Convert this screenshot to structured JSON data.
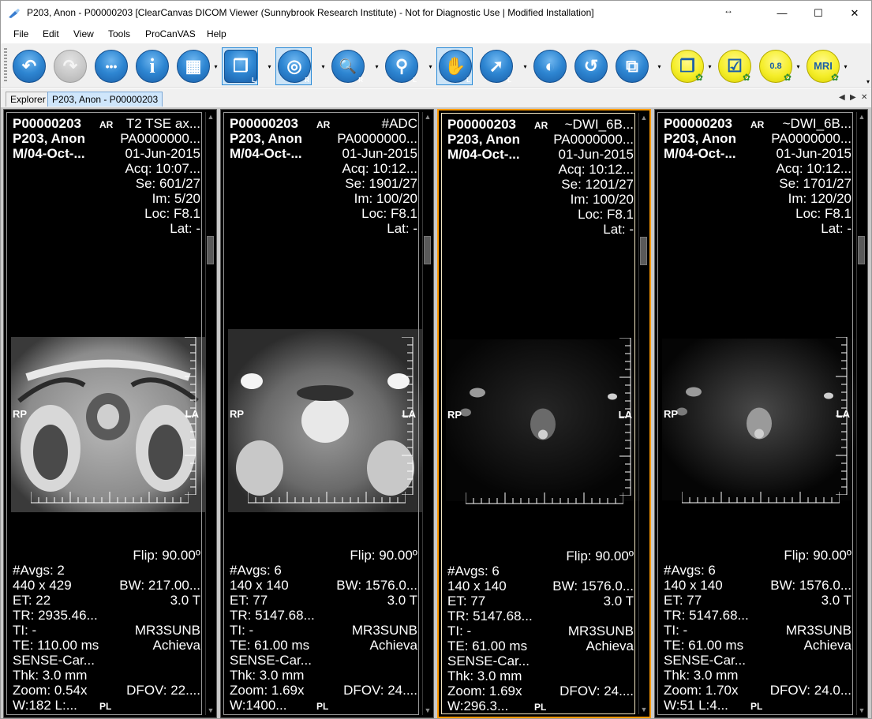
{
  "window": {
    "title": "P203, Anon - P00000203 [ClearCanvas DICOM Viewer (Sunnybrook Research Institute) - Not for Diagnostic Use | Modified Installation]",
    "resize_glyph": "↔",
    "minimize": "—",
    "maximize": "☐",
    "close": "✕"
  },
  "menu": [
    "File",
    "Edit",
    "View",
    "Tools",
    "ProCanVAS",
    "Help"
  ],
  "toolbar": {
    "buttons": [
      {
        "name": "back-icon",
        "glyph": "↶"
      },
      {
        "name": "forward-icon",
        "glyph": "↷"
      },
      {
        "name": "ellipsis-icon",
        "glyph": "•••"
      },
      {
        "name": "info-icon",
        "glyph": "i"
      },
      {
        "name": "layout-icon",
        "glyph": "▦"
      },
      {
        "name": "stack-icon",
        "glyph": "❐",
        "sub": "L"
      },
      {
        "name": "probe-icon",
        "glyph": "◎",
        "sub": "R"
      },
      {
        "name": "zoom-icon",
        "glyph": "🔍",
        "sub": "R"
      },
      {
        "name": "magnify-icon",
        "glyph": "⚲",
        "sub": "L"
      },
      {
        "name": "pan-icon",
        "glyph": "✋",
        "sub": "L"
      },
      {
        "name": "select-icon",
        "glyph": "➚",
        "sub": "L"
      },
      {
        "name": "invert-icon",
        "glyph": "◐"
      },
      {
        "name": "reset-icon",
        "glyph": "↺"
      },
      {
        "name": "sync-icon",
        "glyph": "⧉"
      },
      {
        "name": "procanvas-stack-icon",
        "glyph": "❐"
      },
      {
        "name": "procanvas-check-icon",
        "glyph": "☑"
      },
      {
        "name": "procanvas-08-icon",
        "glyph": "0.8"
      },
      {
        "name": "procanvas-mri-icon",
        "glyph": "MRI"
      }
    ],
    "overflow": "▾"
  },
  "tabs": {
    "explorer": "Explorer",
    "study": "P203, Anon - P00000203",
    "nav_prev": "◀",
    "nav_next": "▶",
    "nav_close": "✕"
  },
  "viewports": [
    {
      "patient_id": "P00000203",
      "patient_name": "P203, Anon",
      "sex_dob": "M/04-Oct-...",
      "orient_top": "AR",
      "series_desc": "T2 TSE ax...",
      "accession": "PA0000000...",
      "study_date": "01-Jun-2015",
      "acq": "Acq: 10:07...",
      "se": "Se: 601/27",
      "im": "Im: 5/20",
      "loc": "Loc: F8.1",
      "lat": "Lat: -",
      "flip": "Flip: 90.00º",
      "avgs": "#Avgs: 2",
      "matrix": "440 x 429",
      "bw": "BW: 217.00...",
      "et": "ET: 22",
      "tesla": "3.0 T",
      "tr": "TR: 2935.46...",
      "ti": "TI: -",
      "station": "MR3SUNB",
      "te": "TE: 110.00 ms",
      "model": "Achieva",
      "coil": "SENSE-Car...",
      "thk": "Thk: 3.0 mm",
      "zoom": "Zoom: 0.54x",
      "dfov": "DFOV: 22....",
      "wl": "W:182 L:...",
      "orient_bottom": "PL",
      "orient_left": "RP",
      "orient_right": "LA"
    },
    {
      "patient_id": "P00000203",
      "patient_name": "P203, Anon",
      "sex_dob": "M/04-Oct-...",
      "orient_top": "AR",
      "series_desc": "#ADC",
      "accession": "PA0000000...",
      "study_date": "01-Jun-2015",
      "acq": "Acq: 10:12...",
      "se": "Se: 1901/27",
      "im": "Im: 100/20",
      "loc": "Loc: F8.1",
      "lat": "Lat: -",
      "flip": "Flip: 90.00º",
      "avgs": "#Avgs: 6",
      "matrix": "140 x 140",
      "bw": "BW: 1576.0...",
      "et": "ET: 77",
      "tesla": "3.0 T",
      "tr": "TR: 5147.68...",
      "ti": "TI: -",
      "station": "MR3SUNB",
      "te": "TE: 61.00 ms",
      "model": "Achieva",
      "coil": "SENSE-Car...",
      "thk": "Thk: 3.0 mm",
      "zoom": "Zoom: 1.69x",
      "dfov": "DFOV: 24....",
      "wl": "W:1400...",
      "orient_bottom": "PL",
      "orient_left": "RP",
      "orient_right": "LA"
    },
    {
      "patient_id": "P00000203",
      "patient_name": "P203, Anon",
      "sex_dob": "M/04-Oct-...",
      "orient_top": "AR",
      "series_desc": "~DWI_6B...",
      "accession": "PA0000000...",
      "study_date": "01-Jun-2015",
      "acq": "Acq: 10:12...",
      "se": "Se: 1201/27",
      "im": "Im: 100/20",
      "loc": "Loc: F8.1",
      "lat": "Lat: -",
      "flip": "Flip: 90.00º",
      "avgs": "#Avgs: 6",
      "matrix": "140 x 140",
      "bw": "BW: 1576.0...",
      "et": "ET: 77",
      "tesla": "3.0 T",
      "tr": "TR: 5147.68...",
      "ti": "TI: -",
      "station": "MR3SUNB",
      "te": "TE: 61.00 ms",
      "model": "Achieva",
      "coil": "SENSE-Car...",
      "thk": "Thk: 3.0 mm",
      "zoom": "Zoom: 1.69x",
      "dfov": "DFOV: 24....",
      "wl": "W:296.3...",
      "orient_bottom": "PL",
      "orient_left": "RP",
      "orient_right": "LA"
    },
    {
      "patient_id": "P00000203",
      "patient_name": "P203, Anon",
      "sex_dob": "M/04-Oct-...",
      "orient_top": "AR",
      "series_desc": "~DWI_6B...",
      "accession": "PA0000000...",
      "study_date": "01-Jun-2015",
      "acq": "Acq: 10:12...",
      "se": "Se: 1701/27",
      "im": "Im: 120/20",
      "loc": "Loc: F8.1",
      "lat": "Lat: -",
      "flip": "Flip: 90.00º",
      "avgs": "#Avgs: 6",
      "matrix": "140 x 140",
      "bw": "BW: 1576.0...",
      "et": "ET: 77",
      "tesla": "3.0 T",
      "tr": "TR: 5147.68...",
      "ti": "TI: -",
      "station": "MR3SUNB",
      "te": "TE: 61.00 ms",
      "model": "Achieva",
      "coil": "SENSE-Car...",
      "thk": "Thk: 3.0 mm",
      "zoom": "Zoom: 1.70x",
      "dfov": "DFOV: 24.0...",
      "wl": "W:51 L:4...",
      "orient_bottom": "PL",
      "orient_left": "RP",
      "orient_right": "LA"
    }
  ],
  "scroll": {
    "up": "▲",
    "down": "▼"
  }
}
